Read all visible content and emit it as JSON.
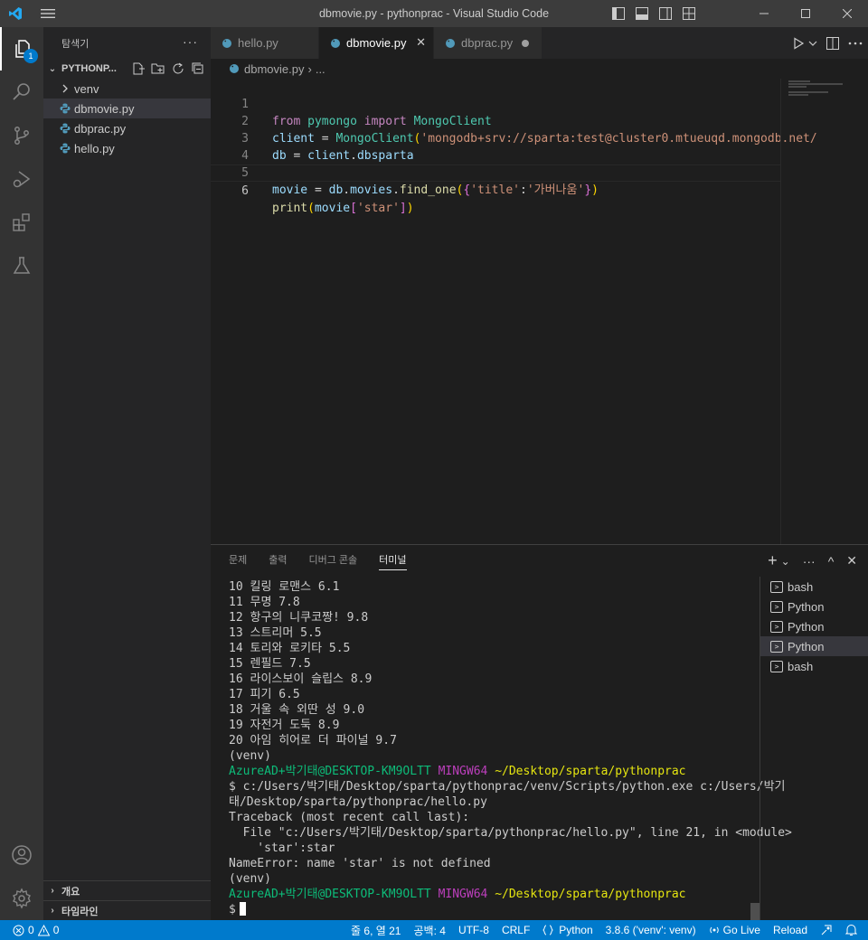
{
  "window": {
    "title": "dbmovie.py - pythonprac - Visual Studio Code"
  },
  "activity_bar": {
    "explorer_badge": "1"
  },
  "sidebar": {
    "header": "탐색기",
    "more": "···",
    "project": "PYTHONP...",
    "items": [
      {
        "label": "venv",
        "type": "folder"
      },
      {
        "label": "dbmovie.py",
        "type": "python",
        "selected": true
      },
      {
        "label": "dbprac.py",
        "type": "python"
      },
      {
        "label": "hello.py",
        "type": "python"
      }
    ],
    "outline": "개요",
    "timeline": "타임라인"
  },
  "tabs": [
    {
      "label": "hello.py",
      "active": false
    },
    {
      "label": "dbmovie.py",
      "active": true,
      "close": "✕"
    },
    {
      "label": "dbprac.py",
      "active": false,
      "dirty": true
    }
  ],
  "breadcrumb": {
    "file": "dbmovie.py",
    "sep": "›",
    "rest": "..."
  },
  "editor": {
    "lines": [
      {
        "n": "1"
      },
      {
        "n": "2"
      },
      {
        "n": "3"
      },
      {
        "n": "4"
      },
      {
        "n": "5"
      },
      {
        "n": "6"
      }
    ],
    "tokens": {
      "from": "from",
      "pymongo": "pymongo",
      "import": "import",
      "MongoClient": "MongoClient",
      "client": "client",
      "eq": " = ",
      "mongo_url": "'mongodb+srv://sparta:test@cluster0.mtueuqd.mongodb.net/",
      "db": "db",
      "dot": ".",
      "dbsparta": "dbsparta",
      "movie": "movie",
      "movies": "movies",
      "find_one": "find_one",
      "title_key": "'title'",
      "colon": ":",
      "title_val": "'가버나움'",
      "print": "print",
      "star_key": "'star'"
    }
  },
  "panel": {
    "tabs": [
      "문제",
      "출력",
      "디버그 콘솔",
      "터미널"
    ],
    "active_tab": "터미널",
    "actions": {
      "add": "+",
      "chevron": "⌄",
      "more": "···",
      "up": "^",
      "close": "✕"
    },
    "terminal": {
      "rows": [
        "10 킬링 로맨스 6.1",
        "11 무명 7.8",
        "12 항구의 니쿠코짱! 9.8",
        "13 스트리머 5.5",
        "14 토리와 로키타 5.5",
        "15 렌필드 7.5",
        "16 라이스보이 슬립스 8.9",
        "17 피기 6.5",
        "18 거울 속 외딴 성 9.0",
        "19 자전거 도둑 8.9",
        "20 아임 히어로 더 파이널 9.7",
        "(venv)"
      ],
      "prompt_user": "AzureAD+박기태@DESKTOP-KM9OLTT",
      "prompt_shell": "MINGW64",
      "prompt_path": "~/Desktop/sparta/pythonprac",
      "command_1": "$ c:/Users/박기태/Desktop/sparta/pythonprac/venv/Scripts/python.exe c:/Users/박기",
      "command_2": "태/Desktop/sparta/pythonprac/hello.py",
      "traceback": "Traceback (most recent call last):",
      "file_line": "  File \"c:/Users/박기태/Desktop/sparta/pythonprac/hello.py\", line 21, in <module>",
      "code_line": "    'star':star",
      "error": "NameError: name 'star' is not defined",
      "venv": "(venv)",
      "dollar": "$"
    },
    "terminal_list": [
      {
        "label": "bash"
      },
      {
        "label": "Python"
      },
      {
        "label": "Python"
      },
      {
        "label": "Python",
        "active": true
      },
      {
        "label": "bash"
      }
    ]
  },
  "statusbar": {
    "errors": "0",
    "warnings": "0",
    "position": "줄 6, 열 21",
    "spaces": "공백: 4",
    "encoding": "UTF-8",
    "eol": "CRLF",
    "language": "Python",
    "interpreter": "3.8.6 ('venv': venv)",
    "golive": "Go Live",
    "reload": "Reload"
  },
  "colors": {
    "accent": "#007acc",
    "keyword": "#c586c0",
    "string": "#ce9178",
    "function": "#dcdcaa",
    "variable": "#9cdcfe",
    "class": "#4ec9b0"
  }
}
